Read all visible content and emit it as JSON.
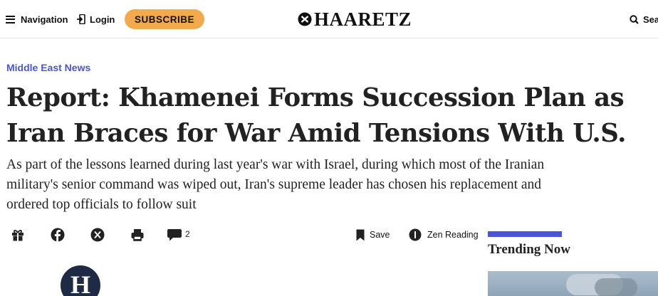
{
  "header": {
    "navigation_label": "Navigation",
    "login_label": "Login",
    "subscribe_label": "SUBSCRIBE",
    "logo_text": "HAARETZ",
    "search_label": "Sea"
  },
  "article": {
    "section": "Middle East News",
    "headline": "Report: Khamenei Forms Succession Plan as Iran Braces for War Amid Tensions With U.S.",
    "dek": "As part of the lessons learned during last year's war with Israel, during which most of the Iranian military's senior command was wiped out, Iran's supreme leader has chosen his replacement and ordered top officials to follow suit",
    "author_initial": "H"
  },
  "sharebar": {
    "icons": [
      "gift-icon",
      "facebook-icon",
      "x-icon",
      "print-icon",
      "comment-icon"
    ],
    "comment_count": "2",
    "save_label": "Save",
    "zen_label": "Zen Reading"
  },
  "trending": {
    "title": "Trending Now"
  },
  "colors": {
    "accent": "#4a55d6",
    "subscribe": "#f2aa4c",
    "avatar_bg": "#1f2b45",
    "text": "#222222"
  }
}
